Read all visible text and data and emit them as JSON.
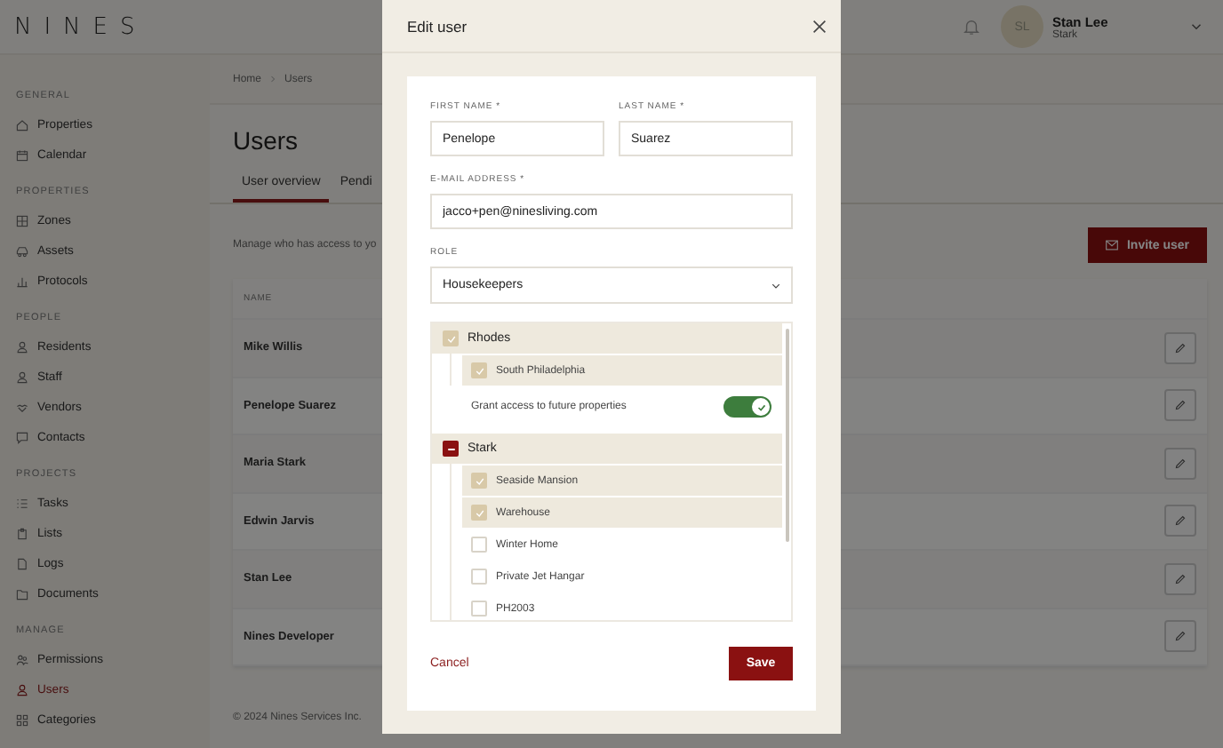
{
  "header": {
    "logo": "NINES",
    "user": {
      "initials": "SL",
      "name": "Stan Lee",
      "organization": "Stark"
    }
  },
  "sidebar": {
    "sections": [
      {
        "title": "GENERAL",
        "items": [
          {
            "label": "Properties",
            "selected": false
          },
          {
            "label": "Calendar",
            "selected": false
          }
        ]
      },
      {
        "title": "PROPERTIES",
        "items": [
          {
            "label": "Zones",
            "selected": false
          },
          {
            "label": "Assets",
            "selected": false
          },
          {
            "label": "Protocols",
            "selected": false
          }
        ]
      },
      {
        "title": "PEOPLE",
        "items": [
          {
            "label": "Residents",
            "selected": false
          },
          {
            "label": "Staff",
            "selected": false
          },
          {
            "label": "Vendors",
            "selected": false
          },
          {
            "label": "Contacts",
            "selected": false
          }
        ]
      },
      {
        "title": "PROJECTS",
        "items": [
          {
            "label": "Tasks",
            "selected": false
          },
          {
            "label": "Lists",
            "selected": false
          },
          {
            "label": "Logs",
            "selected": false
          },
          {
            "label": "Documents",
            "selected": false
          }
        ]
      },
      {
        "title": "MANAGE",
        "items": [
          {
            "label": "Permissions",
            "selected": false
          },
          {
            "label": "Users",
            "selected": true
          },
          {
            "label": "Categories",
            "selected": false
          }
        ]
      }
    ]
  },
  "breadcrumb": [
    "Home",
    "Users"
  ],
  "page_title": "Users",
  "tabs": [
    {
      "label": "User overview",
      "selected": true
    },
    {
      "label": "Pendi",
      "selected": false
    }
  ],
  "description": "Manage who has access to yo",
  "invite_button": "Invite user",
  "table": {
    "columns": [
      "NAME"
    ],
    "rows": [
      {
        "name": "Mike Willis"
      },
      {
        "name": "Penelope Suarez"
      },
      {
        "name": "Maria Stark"
      },
      {
        "name": "Edwin Jarvis"
      },
      {
        "name": "Stan Lee"
      },
      {
        "name": "Nines Developer"
      }
    ]
  },
  "footer": "© 2024 Nines Services Inc.",
  "modal": {
    "title": "Edit user",
    "first_name": {
      "label": "FIRST NAME *",
      "value": "Penelope"
    },
    "last_name": {
      "label": "LAST NAME *",
      "value": "Suarez"
    },
    "email": {
      "label": "E-MAIL ADDRESS *",
      "value": "jacco+pen@ninesliving.com"
    },
    "role": {
      "label": "ROLE",
      "value": "Housekeepers"
    },
    "groups": [
      {
        "name": "Rhodes",
        "checked": true,
        "partial": false,
        "children": [
          {
            "name": "South Philadelphia",
            "checked": true
          }
        ],
        "future_access": {
          "label": "Grant access to future properties",
          "on": true
        }
      },
      {
        "name": "Stark",
        "checked": true,
        "partial": true,
        "children": [
          {
            "name": "Seaside Mansion",
            "checked": true
          },
          {
            "name": "Warehouse",
            "checked": true
          },
          {
            "name": "Winter Home",
            "checked": false
          },
          {
            "name": "Private Jet Hangar",
            "checked": false
          },
          {
            "name": "PH2003",
            "checked": false
          }
        ]
      }
    ],
    "cancel": "Cancel",
    "save": "Save"
  }
}
